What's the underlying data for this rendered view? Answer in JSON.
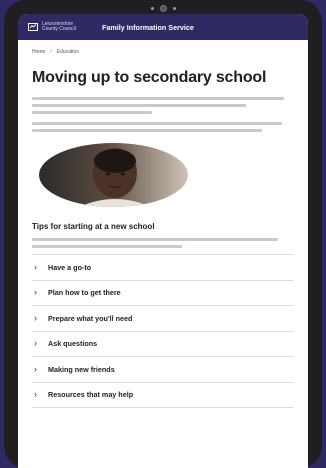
{
  "header": {
    "logo_text": "Leicestershire County Council",
    "site_title": "Family Information Service"
  },
  "breadcrumb": [
    "Home",
    "Education"
  ],
  "page": {
    "title": "Moving up to secondary school"
  },
  "tips": {
    "title": "Tips for starting at a new school"
  },
  "accordion": {
    "items": [
      {
        "label": "Have a go-to"
      },
      {
        "label": "Plan how to get there"
      },
      {
        "label": "Prepare what you'll need"
      },
      {
        "label": "Ask questions"
      },
      {
        "label": "Making new friends"
      },
      {
        "label": "Resources that may help"
      }
    ]
  },
  "colors": {
    "brand": "#2f2a63",
    "device": "#1f1f1f"
  },
  "icons": {
    "accordion": "chevron-right-icon",
    "logo": "council-logo-icon"
  }
}
